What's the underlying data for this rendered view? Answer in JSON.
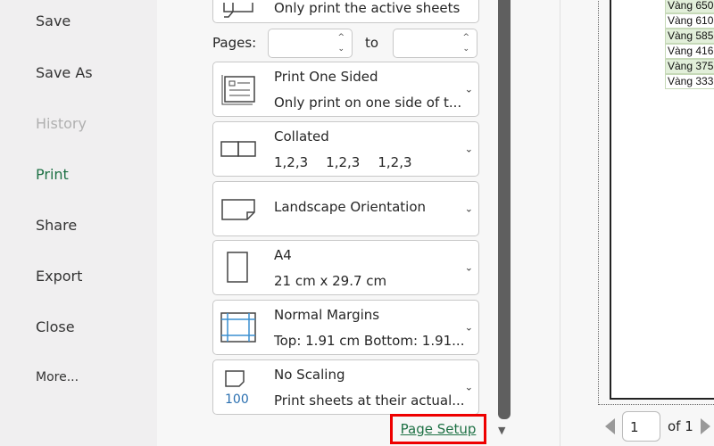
{
  "sidebar": {
    "items": [
      {
        "label": "Save"
      },
      {
        "label": "Save As"
      },
      {
        "label": "History"
      },
      {
        "label": "Print"
      },
      {
        "label": "Share"
      },
      {
        "label": "Export"
      },
      {
        "label": "Close"
      },
      {
        "label": "More..."
      }
    ]
  },
  "settings": {
    "active_sheets_sub": "Only print the active sheets",
    "pages_label": "Pages:",
    "to_label": "to",
    "pages_from": "",
    "pages_to": "",
    "sided": {
      "title": "Print One Sided",
      "sub": "Only print on one side of t..."
    },
    "collated": {
      "title": "Collated",
      "sub": [
        "1,2,3",
        "1,2,3",
        "1,2,3"
      ]
    },
    "orientation": {
      "title": "Landscape Orientation"
    },
    "paper": {
      "title": "A4",
      "sub": "21 cm x 29.7 cm"
    },
    "margins": {
      "title": "Normal Margins",
      "sub": "Top: 1.91 cm Bottom: 1.91..."
    },
    "scaling": {
      "title": "No Scaling",
      "sub": "Print sheets at their actual...",
      "icon_text": "100"
    },
    "page_setup": "Page Setup"
  },
  "preview": {
    "cells": [
      "Vàng 650",
      "Vàng 610",
      "Vàng 585",
      "Vàng 416",
      "Vàng 375",
      "Vàng 333"
    ],
    "current_page": "1",
    "of_label": "of 1"
  }
}
